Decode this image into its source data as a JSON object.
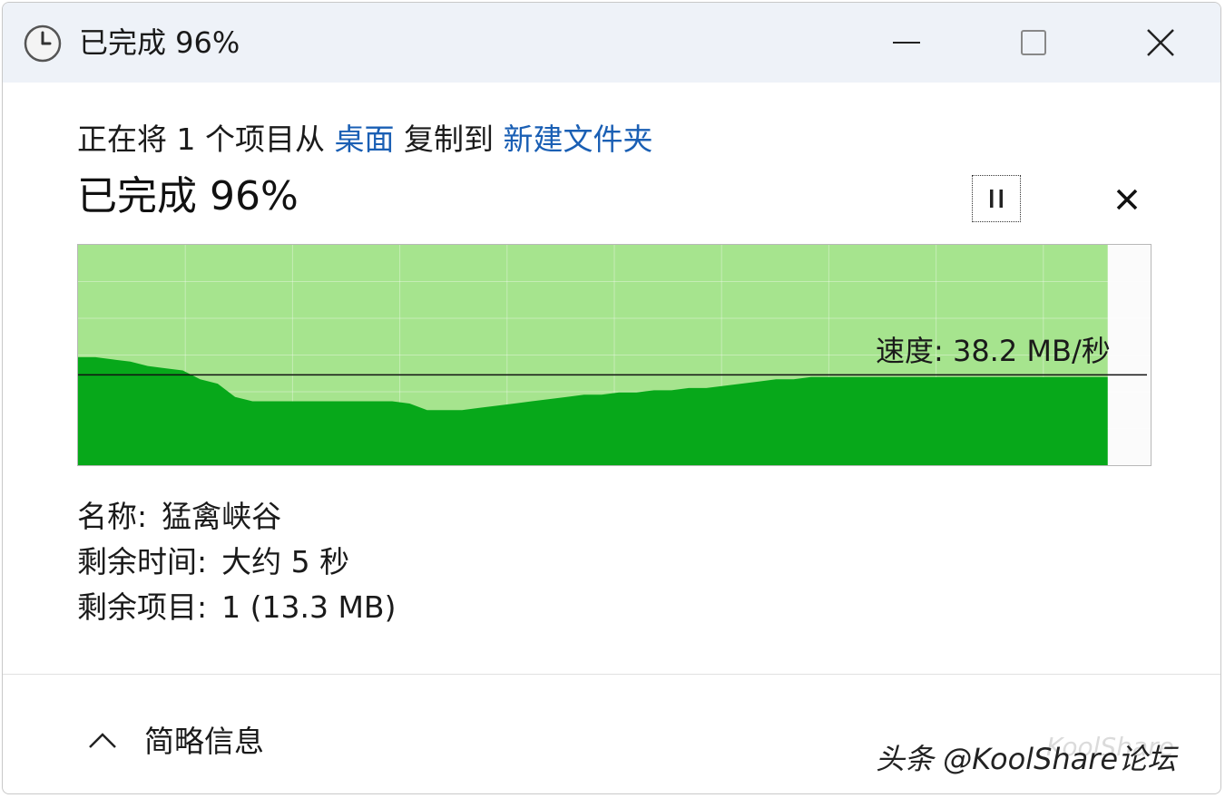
{
  "window": {
    "title": "已完成 96%",
    "icon": "clock-icon",
    "controls": {
      "minimize": "minimize-icon",
      "maximize": "maximize-icon",
      "close": "close-icon"
    }
  },
  "copy": {
    "prefix": "正在将 1 个项目从 ",
    "source": "桌面",
    "middle": " 复制到 ",
    "destination": "新建文件夹",
    "status": "已完成 96%",
    "progress_percent": 96,
    "speed_label": "速度: 38.2 MB/秒",
    "current_speed_fraction": 0.41
  },
  "details": {
    "name_key": "名称:",
    "name_value": "猛禽峡谷",
    "time_key": "剩余时间:",
    "time_value": "大约 5 秒",
    "items_key": "剩余项目:",
    "items_value": "1 (13.3 MB)"
  },
  "footer": {
    "toggle_label": "简略信息",
    "toggle_icon": "chevron-up-icon"
  },
  "watermark": {
    "text": "头条 @KoolShare论坛"
  },
  "colors": {
    "graph_fill": "#07a81a",
    "graph_progress_bg": "#a6e48e",
    "link": "#1a5fb4",
    "titlebar": "#eef2f8"
  },
  "speed_history": [
    0.49,
    0.49,
    0.48,
    0.47,
    0.45,
    0.44,
    0.43,
    0.39,
    0.37,
    0.31,
    0.29,
    0.29,
    0.29,
    0.29,
    0.29,
    0.29,
    0.29,
    0.29,
    0.29,
    0.28,
    0.25,
    0.25,
    0.25,
    0.26,
    0.27,
    0.28,
    0.29,
    0.3,
    0.31,
    0.32,
    0.32,
    0.33,
    0.33,
    0.34,
    0.34,
    0.35,
    0.35,
    0.36,
    0.37,
    0.38,
    0.39,
    0.39,
    0.4,
    0.4,
    0.4,
    0.4,
    0.4,
    0.4,
    0.4,
    0.4,
    0.4,
    0.4,
    0.4,
    0.4,
    0.4,
    0.4,
    0.4,
    0.4,
    0.4,
    0.4
  ]
}
